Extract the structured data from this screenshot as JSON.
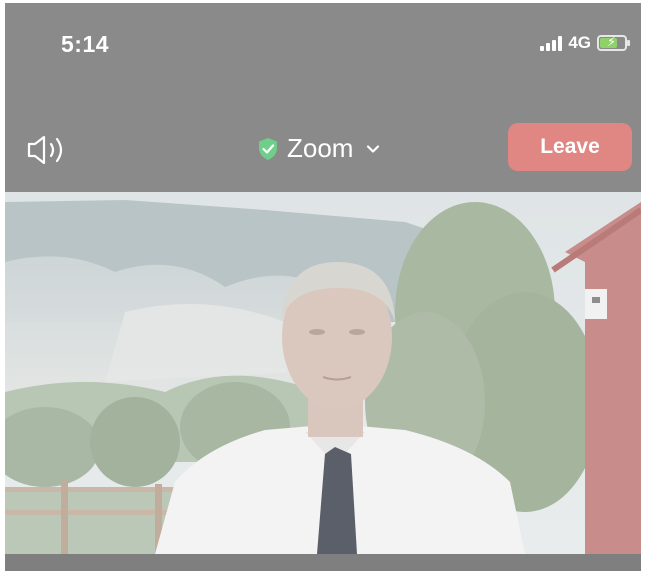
{
  "status_bar": {
    "time": "5:14",
    "network": "4G",
    "battery_level": 0.7,
    "battery_charging": true
  },
  "toolbar": {
    "meeting_title": "Zoom",
    "leave_label": "Leave",
    "leave_color": "#e08783",
    "shield_color": "#6fcf8a"
  },
  "icons": {
    "speaker": "speaker-icon",
    "shield": "shield-check-icon",
    "chevron": "chevron-down-icon"
  }
}
